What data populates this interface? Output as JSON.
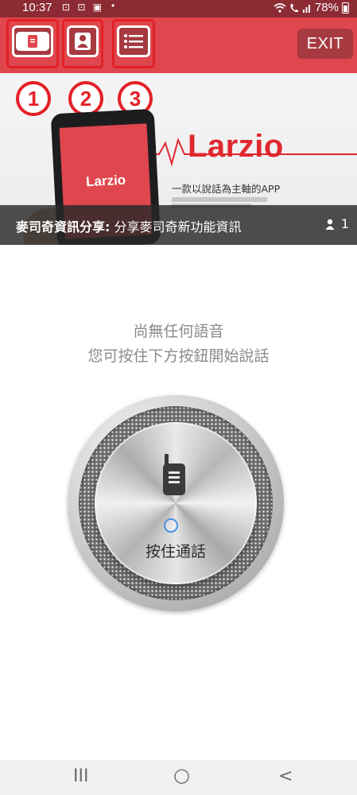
{
  "status_bar": {
    "time": "10:37",
    "battery": "78%",
    "left_icons": [
      "screenshot-icon",
      "screenshot-icon",
      "app-notification-icon",
      "dot-icon"
    ],
    "right_icons": [
      "wifi-icon",
      "wifi-call-icon",
      "signal-icon",
      "battery-icon"
    ]
  },
  "header": {
    "exit_label": "EXIT",
    "nav_buttons": [
      {
        "badge": "1",
        "icon": "walkie-talkie-icon"
      },
      {
        "badge": "2",
        "icon": "person-icon"
      },
      {
        "badge": "3",
        "icon": "list-icon"
      }
    ],
    "highlight_color": "#e32027"
  },
  "banner": {
    "brand": "Larzio",
    "phone_logo": "Larzio",
    "tagline": "一款以說話為主軸的APP"
  },
  "channel": {
    "name": "麥司奇資訊分享",
    "separator": ":",
    "description": "分享麥司奇新功能資訊",
    "member_count": "1"
  },
  "empty_state": {
    "line1": "尚無任何語音",
    "line2": "您可按住下方按鈕開始說話"
  },
  "ptt": {
    "label": "按住通話"
  },
  "navbar": {
    "recents": "III",
    "home": "○",
    "back": "<"
  },
  "colors": {
    "brand_red": "#e0464d",
    "dark_red_button": "#a63a40"
  }
}
